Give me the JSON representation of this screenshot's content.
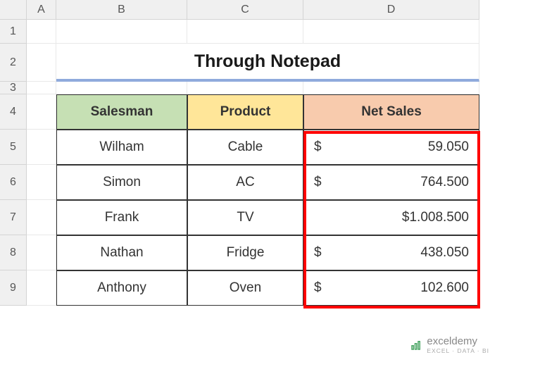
{
  "columns": [
    "A",
    "B",
    "C",
    "D"
  ],
  "rows": [
    "1",
    "2",
    "3",
    "4",
    "5",
    "6",
    "7",
    "8",
    "9"
  ],
  "title": "Through Notepad",
  "headers": {
    "salesman": "Salesman",
    "product": "Product",
    "netsales": "Net Sales"
  },
  "data": [
    {
      "salesman": "Wilham",
      "product": "Cable",
      "sales_sym": "$",
      "sales_val": "59.050",
      "centered": false
    },
    {
      "salesman": "Simon",
      "product": "AC",
      "sales_sym": "$",
      "sales_val": "764.500",
      "centered": false
    },
    {
      "salesman": "Frank",
      "product": "TV",
      "sales_sym": "",
      "sales_val": "$1.008.500",
      "centered": true
    },
    {
      "salesman": "Nathan",
      "product": "Fridge",
      "sales_sym": "$",
      "sales_val": "438.050",
      "centered": false
    },
    {
      "salesman": "Anthony",
      "product": "Oven",
      "sales_sym": "$",
      "sales_val": "102.600",
      "centered": false
    }
  ],
  "brand": {
    "name": "exceldemy",
    "tagline": "EXCEL · DATA · BI"
  },
  "chart_data": {
    "type": "table",
    "title": "Through Notepad",
    "columns": [
      "Salesman",
      "Product",
      "Net Sales"
    ],
    "rows": [
      [
        "Wilham",
        "Cable",
        "$ 59.050"
      ],
      [
        "Simon",
        "AC",
        "$ 764.500"
      ],
      [
        "Frank",
        "TV",
        "$1.008.500"
      ],
      [
        "Nathan",
        "Fridge",
        "$ 438.050"
      ],
      [
        "Anthony",
        "Oven",
        "$ 102.600"
      ]
    ]
  }
}
